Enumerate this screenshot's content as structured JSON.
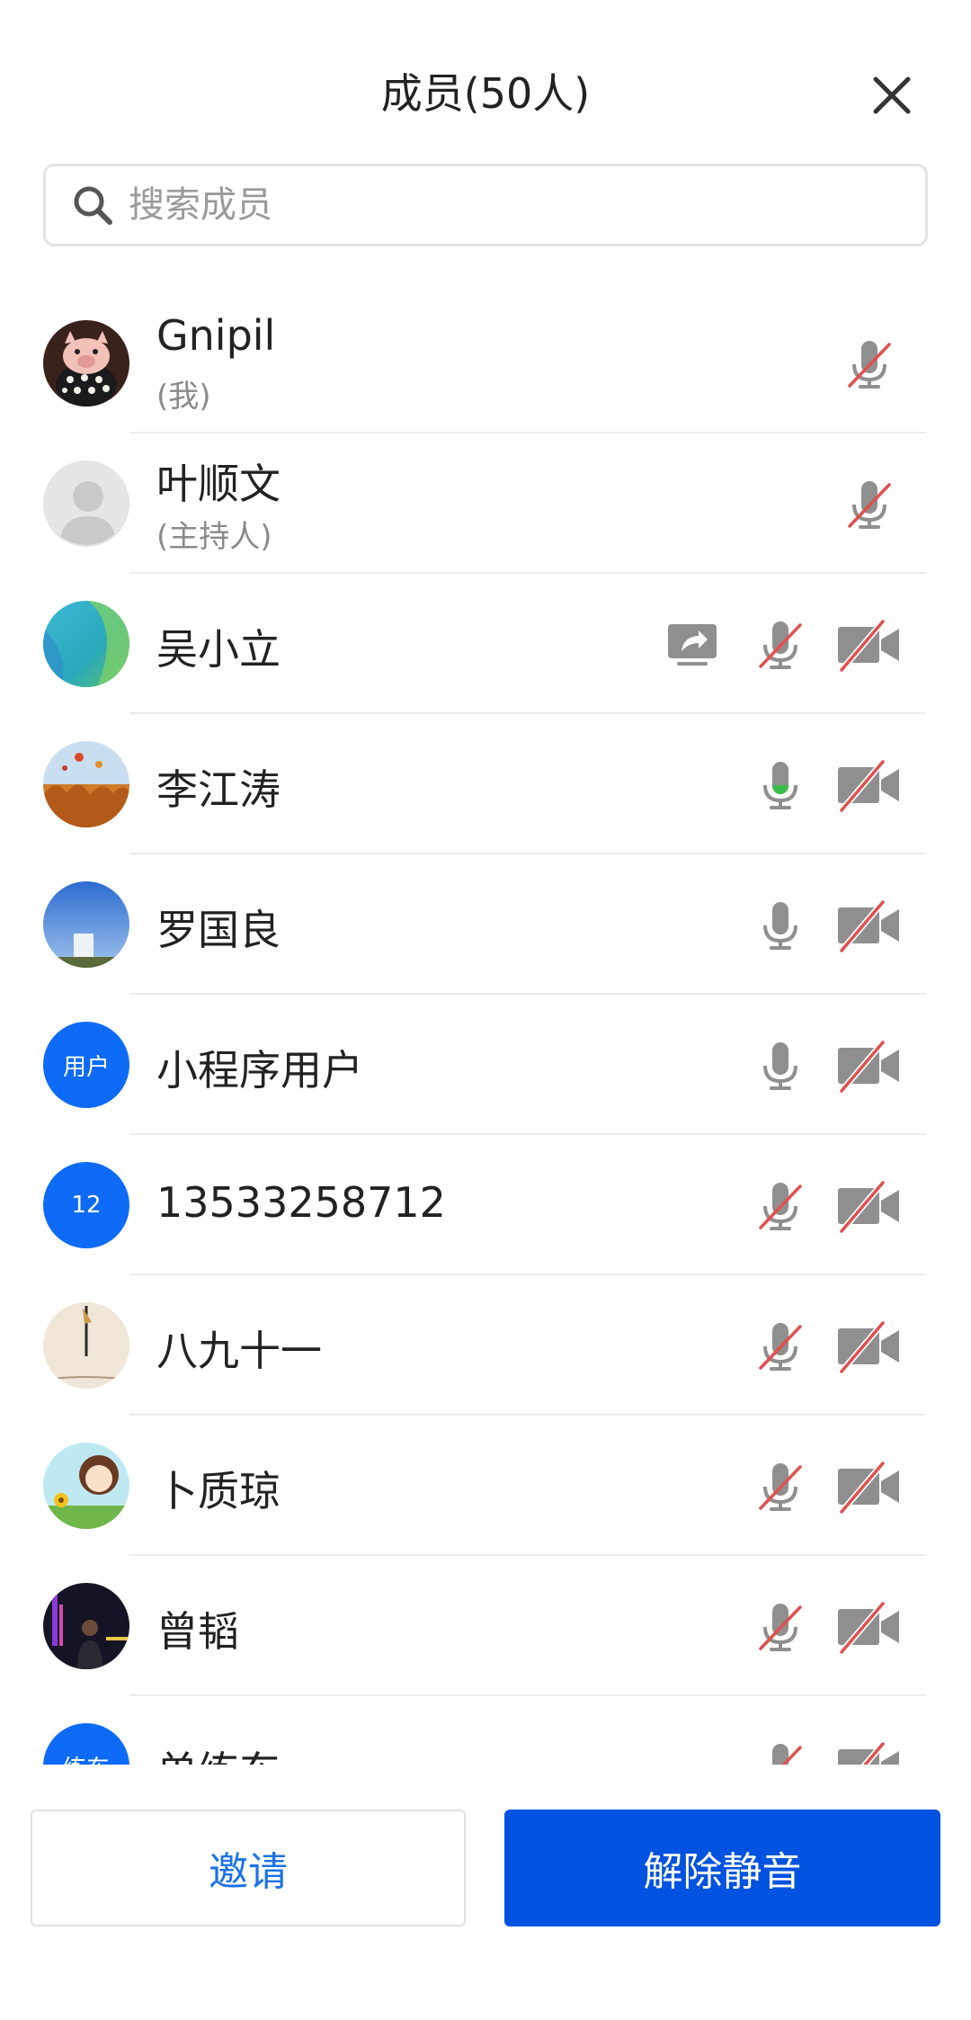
{
  "header": {
    "title": "成员(50人)"
  },
  "search": {
    "placeholder": "搜索成员"
  },
  "members": [
    {
      "name": "Gnipil",
      "subtitle": "(我)",
      "avatar": "pig",
      "share": false,
      "mic": "muted",
      "cam": "none"
    },
    {
      "name": "叶顺文",
      "subtitle": "(主持人)",
      "avatar": "default",
      "share": false,
      "mic": "muted",
      "cam": "none"
    },
    {
      "name": "吴小立",
      "avatar": "gradient",
      "share": true,
      "mic": "muted",
      "cam": "off"
    },
    {
      "name": "李江涛",
      "avatar": "balloons",
      "share": false,
      "mic": "speaking",
      "cam": "off"
    },
    {
      "name": "罗国良",
      "avatar": "sky",
      "share": false,
      "mic": "on",
      "cam": "off"
    },
    {
      "name": "小程序用户",
      "avatar": "text",
      "avatar_text": "用户",
      "share": false,
      "mic": "on",
      "cam": "off"
    },
    {
      "name": "13533258712",
      "avatar": "text",
      "avatar_text": "12",
      "share": false,
      "mic": "muted",
      "cam": "off"
    },
    {
      "name": "八九十一",
      "avatar": "clock",
      "share": false,
      "mic": "muted",
      "cam": "off"
    },
    {
      "name": "卜质琼",
      "avatar": "cartoon",
      "share": false,
      "mic": "muted",
      "cam": "off"
    },
    {
      "name": "曾韬",
      "avatar": "night",
      "share": false,
      "mic": "muted",
      "cam": "off"
    },
    {
      "name": "单练东",
      "avatar": "text",
      "avatar_text": "练东",
      "share": false,
      "mic": "muted",
      "cam": "off"
    }
  ],
  "footer": {
    "invite_label": "邀请",
    "unmute_all_label": "解除静音"
  },
  "colors": {
    "accent": "#0052e0",
    "invite_text": "#1a73e8",
    "avatar_blue": "#0e6bf7",
    "muted_slash": "#e05050",
    "speaking": "#3dbb4a",
    "icon_gray": "#8f8f8f"
  }
}
